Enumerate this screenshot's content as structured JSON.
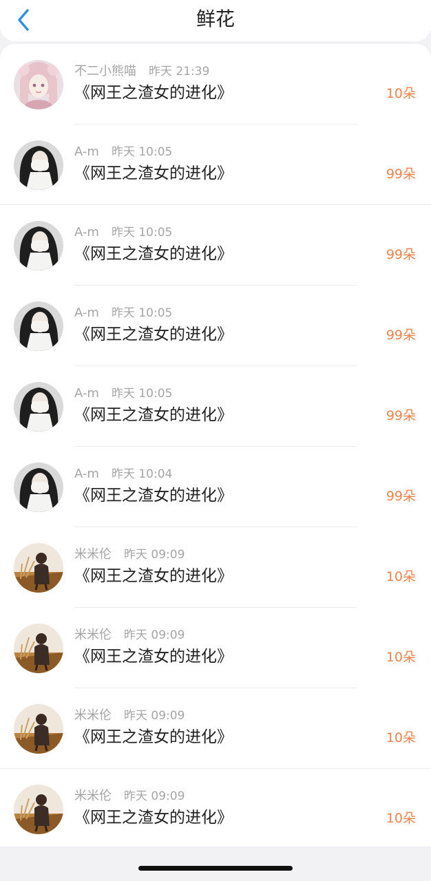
{
  "header": {
    "title": "鲜花"
  },
  "records": [
    {
      "user": "不二小熊喵",
      "time": "昨天 21:39",
      "book": "《网王之渣女的进化》",
      "amount": "10朵",
      "avatar": "pink-hair-girl"
    },
    {
      "user": "A-m",
      "time": "昨天 10:05",
      "book": "《网王之渣女的进化》",
      "amount": "99朵",
      "avatar": "dark-hair-girl"
    },
    {
      "user": "A-m",
      "time": "昨天 10:05",
      "book": "《网王之渣女的进化》",
      "amount": "99朵",
      "avatar": "dark-hair-girl"
    },
    {
      "user": "A-m",
      "time": "昨天 10:05",
      "book": "《网王之渣女的进化》",
      "amount": "99朵",
      "avatar": "dark-hair-girl"
    },
    {
      "user": "A-m",
      "time": "昨天 10:05",
      "book": "《网王之渣女的进化》",
      "amount": "99朵",
      "avatar": "dark-hair-girl"
    },
    {
      "user": "A-m",
      "time": "昨天 10:04",
      "book": "《网王之渣女的进化》",
      "amount": "99朵",
      "avatar": "dark-hair-girl"
    },
    {
      "user": "米米伦",
      "time": "昨天 09:09",
      "book": "《网王之渣女的进化》",
      "amount": "10朵",
      "avatar": "boy-in-field"
    },
    {
      "user": "米米伦",
      "time": "昨天 09:09",
      "book": "《网王之渣女的进化》",
      "amount": "10朵",
      "avatar": "boy-in-field"
    },
    {
      "user": "米米伦",
      "time": "昨天 09:09",
      "book": "《网王之渣女的进化》",
      "amount": "10朵",
      "avatar": "boy-in-field"
    },
    {
      "user": "米米伦",
      "time": "昨天 09:09",
      "book": "《网王之渣女的进化》",
      "amount": "10朵",
      "avatar": "boy-in-field"
    }
  ],
  "colors": {
    "accent": "#f0824b",
    "back": "#2f8fe8",
    "muted": "#a5a5a5",
    "text": "#222222"
  }
}
